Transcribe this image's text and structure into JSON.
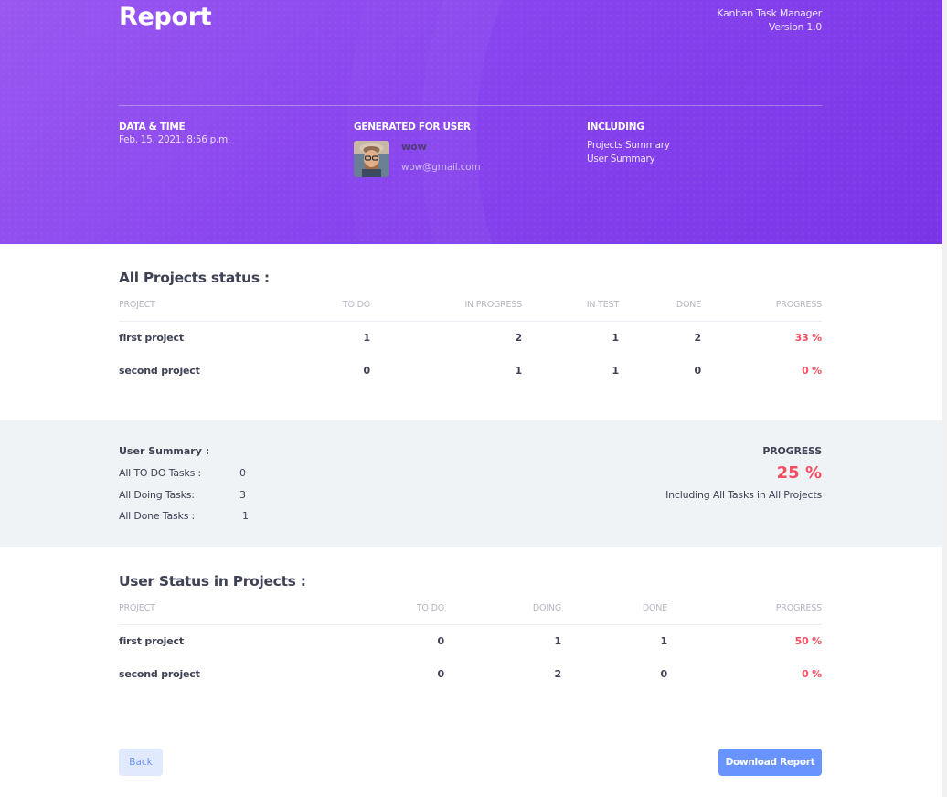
{
  "header": {
    "title": "Report",
    "app_name": "Kanban Task Manager",
    "version": "Version 1.0",
    "date_label": "DATA & TIME",
    "date_value": "Feb. 15, 2021, 8:56 p.m.",
    "user_label": "GENERATED FOR USER",
    "user_name": "wow",
    "user_email": "wow@gmail.com",
    "including_label": "INCLUDING",
    "including_items": [
      "Projects Summary",
      "User Summary"
    ]
  },
  "projects_status": {
    "title": "All Projects status :",
    "columns": [
      "PROJECT",
      "TO DO",
      "IN PROGRESS",
      "IN TEST",
      "DONE",
      "PROGRESS"
    ],
    "rows": [
      {
        "project": "first project",
        "todo": "1",
        "in_progress": "2",
        "in_test": "1",
        "done": "2",
        "progress": "33 %"
      },
      {
        "project": "second project",
        "todo": "0",
        "in_progress": "1",
        "in_test": "1",
        "done": "0",
        "progress": "0 %"
      }
    ]
  },
  "user_summary": {
    "title": "User Summary :",
    "items": [
      {
        "label": "All TO DO Tasks :",
        "value": "0"
      },
      {
        "label": "All Doing Tasks:",
        "value": "3"
      },
      {
        "label": "All Done Tasks :",
        "value": "1"
      }
    ],
    "progress_label": "PROGRESS",
    "progress_value": "25 %",
    "progress_note": "Including All Tasks in All Projects"
  },
  "user_status": {
    "title": "User Status in Projects :",
    "columns": [
      "PROJECT",
      "TO DO",
      "DOING",
      "DONE",
      "PROGRESS"
    ],
    "rows": [
      {
        "project": "first project",
        "todo": "0",
        "doing": "1",
        "done": "1",
        "progress": "50 %"
      },
      {
        "project": "second project",
        "todo": "0",
        "doing": "2",
        "done": "0",
        "progress": "0 %"
      }
    ]
  },
  "actions": {
    "back_label": "Back",
    "download_label": "Download Report"
  },
  "colors": {
    "hero_purple": "#8844ee",
    "progress_red": "#f64e60",
    "primary_blue": "#6993ff",
    "summary_band": "#f0f3f6"
  }
}
